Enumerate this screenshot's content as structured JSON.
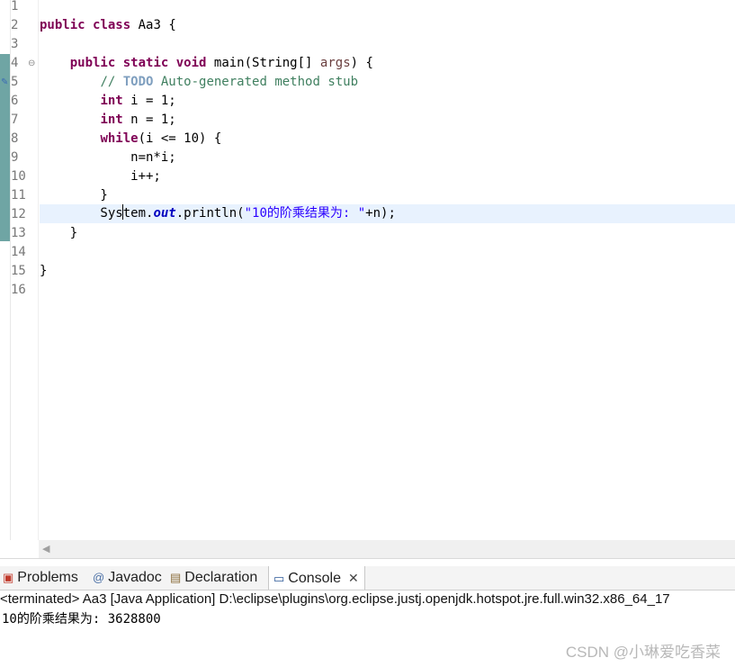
{
  "editor": {
    "line_numbers": [
      "1",
      "2",
      "3",
      "4",
      "5",
      "6",
      "7",
      "8",
      "9",
      "10",
      "11",
      "12",
      "13",
      "14",
      "15",
      "16"
    ],
    "lines": {
      "l2": {
        "kw1": "public",
        "kw2": "class",
        "rest": " Aa3 {"
      },
      "l4": {
        "indent": "    ",
        "kw1": "public",
        "kw2": "static",
        "kw3": "void",
        "rest1": " main(String[] ",
        "var": "args",
        "rest2": ") {"
      },
      "l5": {
        "indent": "        ",
        "comment": "// ",
        "todo": "TODO",
        "comment2": " Auto-generated method stub"
      },
      "l6": {
        "indent": "        ",
        "kw": "int",
        "rest": " i = 1;"
      },
      "l7": {
        "indent": "        ",
        "kw": "int",
        "rest": " n = 1;"
      },
      "l8": {
        "indent": "        ",
        "kw": "while",
        "rest": "(i <= 10) {"
      },
      "l9": {
        "text": "            n=n*i;"
      },
      "l10": {
        "text": "            i++;"
      },
      "l11": {
        "text": "        }"
      },
      "l12": {
        "pre": "        Sys",
        "post": "tem.",
        "field": "out",
        "rest1": ".println(",
        "str": "\"10的阶乘结果为: \"",
        "rest2": "+n);"
      },
      "l13": {
        "text": "    }"
      },
      "l15": {
        "text": "}"
      }
    }
  },
  "bottom_tabs": [
    {
      "label": "Problems",
      "icon": "problems-icon"
    },
    {
      "label": "Javadoc",
      "icon": "javadoc-icon"
    },
    {
      "label": "Declaration",
      "icon": "declaration-icon"
    },
    {
      "label": "Console",
      "icon": "console-icon",
      "close": "✕"
    }
  ],
  "console": {
    "header": "<terminated> Aa3 [Java Application] D:\\eclipse\\plugins\\org.eclipse.justj.openjdk.hotspot.jre.full.win32.x86_64_17",
    "output": "10的阶乘结果为: 3628800"
  },
  "watermark": "CSDN @小琳爱吃香菜"
}
